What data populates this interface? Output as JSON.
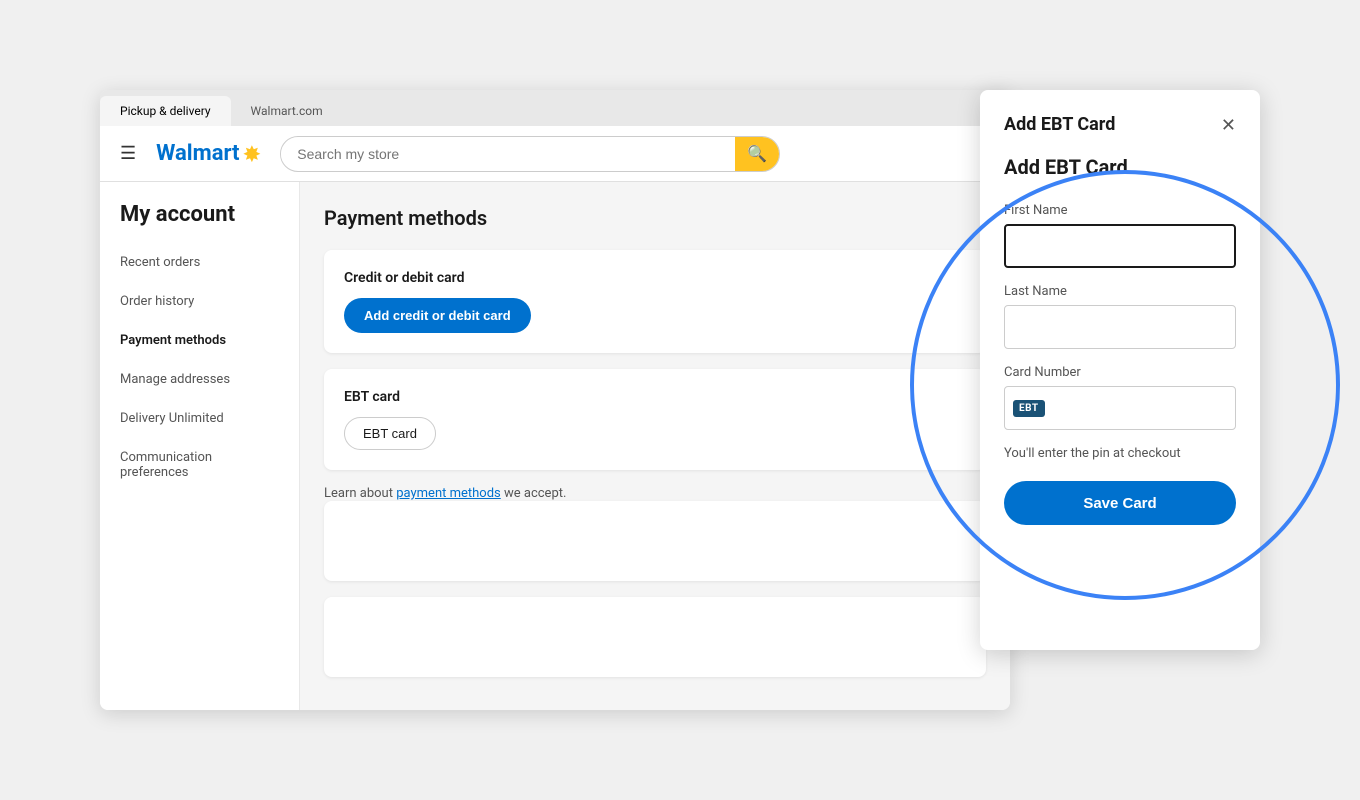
{
  "browser": {
    "tab1": "Pickup & delivery",
    "tab2": "Walmart.com"
  },
  "header": {
    "search_placeholder": "Search my store",
    "logo_text": "Walmart",
    "spark": "✸"
  },
  "sidebar": {
    "title": "My account",
    "items": [
      {
        "label": "Recent orders"
      },
      {
        "label": "Order history"
      },
      {
        "label": "Payment methods"
      },
      {
        "label": "Manage addresses"
      },
      {
        "label": "Delivery Unlimited"
      },
      {
        "label": "Communication preferences"
      }
    ]
  },
  "payment": {
    "title": "Payment methods",
    "credit_section_label": "Credit or debit card",
    "add_card_btn": "Add credit or debit card",
    "ebt_section_label": "EBT card",
    "ebt_btn": "EBT card",
    "learn_text": "Learn about ",
    "learn_link": "payment methods",
    "learn_suffix": " we accept."
  },
  "modal": {
    "header_title": "Add EBT Card",
    "form_title": "Add EBT Card",
    "first_name_label": "First Name",
    "last_name_label": "Last Name",
    "card_number_label": "Card Number",
    "ebt_badge": "EBT",
    "pin_note": "You'll enter the pin at checkout",
    "save_btn": "Save Card"
  }
}
